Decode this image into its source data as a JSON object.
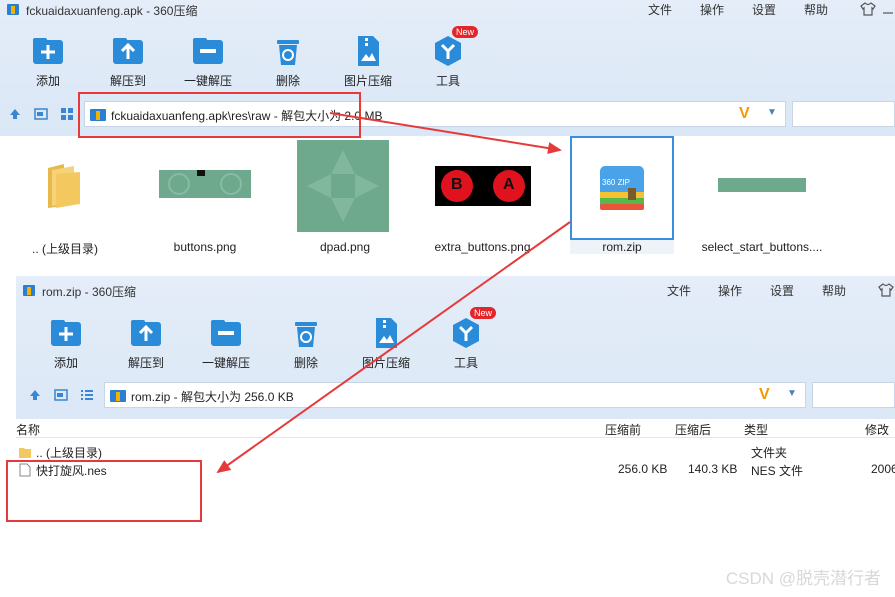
{
  "window1": {
    "title": "fckuaidaxuanfeng.apk - 360压缩",
    "menu": [
      "文件",
      "操作",
      "设置",
      "帮助"
    ],
    "toolbar": [
      {
        "label": "添加",
        "icon": "add-icon"
      },
      {
        "label": "解压到",
        "icon": "extract-to-icon"
      },
      {
        "label": "一键解压",
        "icon": "one-click-extract-icon"
      },
      {
        "label": "删除",
        "icon": "trash-icon"
      },
      {
        "label": "图片压缩",
        "icon": "image-compress-icon"
      },
      {
        "label": "工具",
        "icon": "tools-icon"
      }
    ],
    "badge": "New",
    "address": "fckuaidaxuanfeng.apk\\res\\raw - 解包大小为 2.0 MB",
    "files": [
      {
        "name": ".. (上级目录)",
        "icon": "folder-icon"
      },
      {
        "name": "buttons.png",
        "icon": "image-thumbnail"
      },
      {
        "name": "dpad.png",
        "icon": "image-thumbnail"
      },
      {
        "name": "extra_buttons.png",
        "icon": "image-thumbnail"
      },
      {
        "name": "rom.zip",
        "icon": "zip-archive-icon"
      },
      {
        "name": "select_start_buttons....",
        "icon": "image-thumbnail"
      }
    ],
    "extra_buttons_letters": [
      "B",
      "A"
    ],
    "zip_icon_text": "360 ZIP"
  },
  "window2": {
    "title": "rom.zip - 360压缩",
    "menu": [
      "文件",
      "操作",
      "设置",
      "帮助"
    ],
    "toolbar": [
      {
        "label": "添加",
        "icon": "add-icon"
      },
      {
        "label": "解压到",
        "icon": "extract-to-icon"
      },
      {
        "label": "一键解压",
        "icon": "one-click-extract-icon"
      },
      {
        "label": "删除",
        "icon": "trash-icon"
      },
      {
        "label": "图片压缩",
        "icon": "image-compress-icon"
      },
      {
        "label": "工具",
        "icon": "tools-icon"
      }
    ],
    "badge": "New",
    "address": "rom.zip - 解包大小为 256.0 KB",
    "columns": [
      "名称",
      "压缩前",
      "压缩后",
      "类型",
      "修改"
    ],
    "rows": [
      {
        "name": ".. (上级目录)",
        "before": "",
        "after": "",
        "type": "文件夹",
        "modified": ""
      },
      {
        "name": "快打旋风.nes",
        "before": "256.0 KB",
        "after": "140.3 KB",
        "type": "NES 文件",
        "modified": "2006"
      }
    ]
  },
  "watermark": "CSDN @脱壳潜行者",
  "colors": {
    "accent": "#2a8bd8",
    "annotation": "#e63a3a",
    "logo": "#f39a00"
  }
}
